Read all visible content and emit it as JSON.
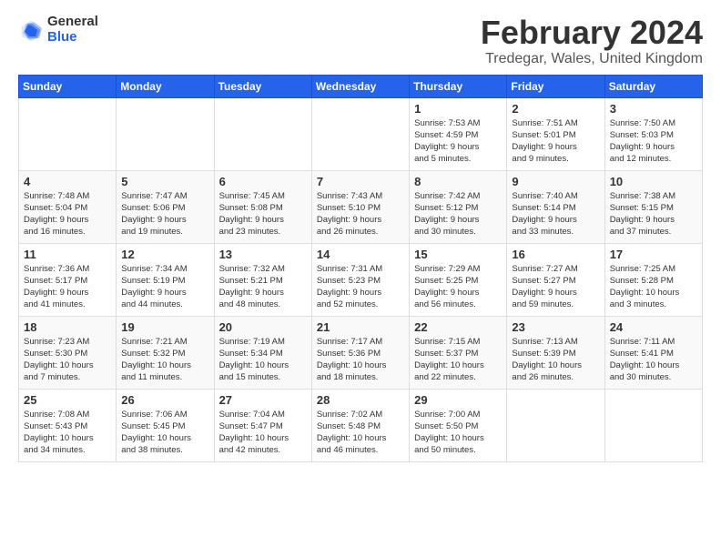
{
  "logo": {
    "general": "General",
    "blue": "Blue"
  },
  "title": "February 2024",
  "subtitle": "Tredegar, Wales, United Kingdom",
  "calendar": {
    "headers": [
      "Sunday",
      "Monday",
      "Tuesday",
      "Wednesday",
      "Thursday",
      "Friday",
      "Saturday"
    ],
    "weeks": [
      [
        {
          "day": "",
          "info": ""
        },
        {
          "day": "",
          "info": ""
        },
        {
          "day": "",
          "info": ""
        },
        {
          "day": "",
          "info": ""
        },
        {
          "day": "1",
          "info": "Sunrise: 7:53 AM\nSunset: 4:59 PM\nDaylight: 9 hours\nand 5 minutes."
        },
        {
          "day": "2",
          "info": "Sunrise: 7:51 AM\nSunset: 5:01 PM\nDaylight: 9 hours\nand 9 minutes."
        },
        {
          "day": "3",
          "info": "Sunrise: 7:50 AM\nSunset: 5:03 PM\nDaylight: 9 hours\nand 12 minutes."
        }
      ],
      [
        {
          "day": "4",
          "info": "Sunrise: 7:48 AM\nSunset: 5:04 PM\nDaylight: 9 hours\nand 16 minutes."
        },
        {
          "day": "5",
          "info": "Sunrise: 7:47 AM\nSunset: 5:06 PM\nDaylight: 9 hours\nand 19 minutes."
        },
        {
          "day": "6",
          "info": "Sunrise: 7:45 AM\nSunset: 5:08 PM\nDaylight: 9 hours\nand 23 minutes."
        },
        {
          "day": "7",
          "info": "Sunrise: 7:43 AM\nSunset: 5:10 PM\nDaylight: 9 hours\nand 26 minutes."
        },
        {
          "day": "8",
          "info": "Sunrise: 7:42 AM\nSunset: 5:12 PM\nDaylight: 9 hours\nand 30 minutes."
        },
        {
          "day": "9",
          "info": "Sunrise: 7:40 AM\nSunset: 5:14 PM\nDaylight: 9 hours\nand 33 minutes."
        },
        {
          "day": "10",
          "info": "Sunrise: 7:38 AM\nSunset: 5:15 PM\nDaylight: 9 hours\nand 37 minutes."
        }
      ],
      [
        {
          "day": "11",
          "info": "Sunrise: 7:36 AM\nSunset: 5:17 PM\nDaylight: 9 hours\nand 41 minutes."
        },
        {
          "day": "12",
          "info": "Sunrise: 7:34 AM\nSunset: 5:19 PM\nDaylight: 9 hours\nand 44 minutes."
        },
        {
          "day": "13",
          "info": "Sunrise: 7:32 AM\nSunset: 5:21 PM\nDaylight: 9 hours\nand 48 minutes."
        },
        {
          "day": "14",
          "info": "Sunrise: 7:31 AM\nSunset: 5:23 PM\nDaylight: 9 hours\nand 52 minutes."
        },
        {
          "day": "15",
          "info": "Sunrise: 7:29 AM\nSunset: 5:25 PM\nDaylight: 9 hours\nand 56 minutes."
        },
        {
          "day": "16",
          "info": "Sunrise: 7:27 AM\nSunset: 5:27 PM\nDaylight: 9 hours\nand 59 minutes."
        },
        {
          "day": "17",
          "info": "Sunrise: 7:25 AM\nSunset: 5:28 PM\nDaylight: 10 hours\nand 3 minutes."
        }
      ],
      [
        {
          "day": "18",
          "info": "Sunrise: 7:23 AM\nSunset: 5:30 PM\nDaylight: 10 hours\nand 7 minutes."
        },
        {
          "day": "19",
          "info": "Sunrise: 7:21 AM\nSunset: 5:32 PM\nDaylight: 10 hours\nand 11 minutes."
        },
        {
          "day": "20",
          "info": "Sunrise: 7:19 AM\nSunset: 5:34 PM\nDaylight: 10 hours\nand 15 minutes."
        },
        {
          "day": "21",
          "info": "Sunrise: 7:17 AM\nSunset: 5:36 PM\nDaylight: 10 hours\nand 18 minutes."
        },
        {
          "day": "22",
          "info": "Sunrise: 7:15 AM\nSunset: 5:37 PM\nDaylight: 10 hours\nand 22 minutes."
        },
        {
          "day": "23",
          "info": "Sunrise: 7:13 AM\nSunset: 5:39 PM\nDaylight: 10 hours\nand 26 minutes."
        },
        {
          "day": "24",
          "info": "Sunrise: 7:11 AM\nSunset: 5:41 PM\nDaylight: 10 hours\nand 30 minutes."
        }
      ],
      [
        {
          "day": "25",
          "info": "Sunrise: 7:08 AM\nSunset: 5:43 PM\nDaylight: 10 hours\nand 34 minutes."
        },
        {
          "day": "26",
          "info": "Sunrise: 7:06 AM\nSunset: 5:45 PM\nDaylight: 10 hours\nand 38 minutes."
        },
        {
          "day": "27",
          "info": "Sunrise: 7:04 AM\nSunset: 5:47 PM\nDaylight: 10 hours\nand 42 minutes."
        },
        {
          "day": "28",
          "info": "Sunrise: 7:02 AM\nSunset: 5:48 PM\nDaylight: 10 hours\nand 46 minutes."
        },
        {
          "day": "29",
          "info": "Sunrise: 7:00 AM\nSunset: 5:50 PM\nDaylight: 10 hours\nand 50 minutes."
        },
        {
          "day": "",
          "info": ""
        },
        {
          "day": "",
          "info": ""
        }
      ]
    ]
  }
}
